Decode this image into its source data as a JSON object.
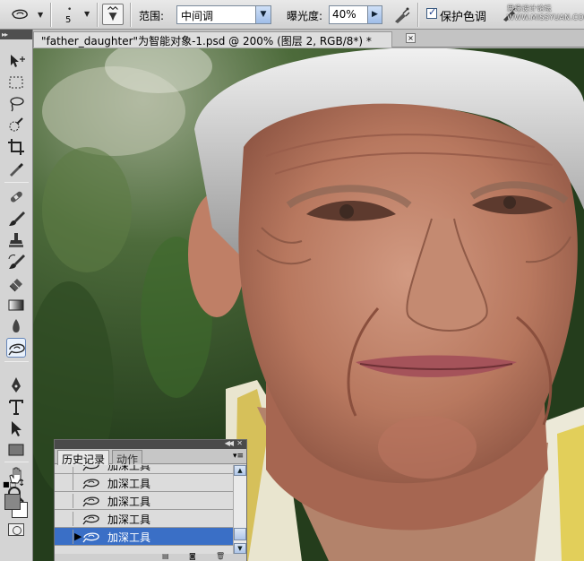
{
  "options_bar": {
    "brush_size": "5",
    "range_label": "范围:",
    "range_value": "中间调",
    "exposure_label": "曝光度:",
    "exposure_value": "40%",
    "protect_tones_label": "保护色调",
    "protect_tones_checked": true,
    "watermark": "思缘设计论坛 WWW.MISSYUAN.COM"
  },
  "tools_panel": {
    "tools": [
      "move-tool",
      "marquee-tool",
      "lasso-tool",
      "quick-selection-tool",
      "crop-tool",
      "eyedropper-tool",
      "healing-brush-tool",
      "brush-tool",
      "clone-stamp-tool",
      "history-brush-tool",
      "eraser-tool",
      "gradient-tool",
      "blur-tool",
      "burn-tool",
      "pen-tool",
      "type-tool",
      "path-selection-tool",
      "rectangle-tool",
      "hand-tool",
      "zoom-tool"
    ],
    "active_tool": "burn-tool",
    "foreground_color": "#888888",
    "background_color": "#ffffff"
  },
  "document": {
    "tab_title": "\"father_daughter\"为智能对象-1.psd @ 200% (图层 2, RGB/8*) *",
    "close_label": "×"
  },
  "history_panel": {
    "tabs": [
      "历史记录",
      "动作"
    ],
    "active_tab": "历史记录",
    "items": [
      {
        "label": "加深工具",
        "selected": false
      },
      {
        "label": "加深工具",
        "selected": false
      },
      {
        "label": "加深工具",
        "selected": false
      },
      {
        "label": "加深工具",
        "selected": false
      },
      {
        "label": "加深工具",
        "selected": true
      }
    ]
  },
  "colors": {
    "selection": "#3a6fc6",
    "panel_bg": "#d4d4d4",
    "titlebar": "#4a4a4a"
  }
}
